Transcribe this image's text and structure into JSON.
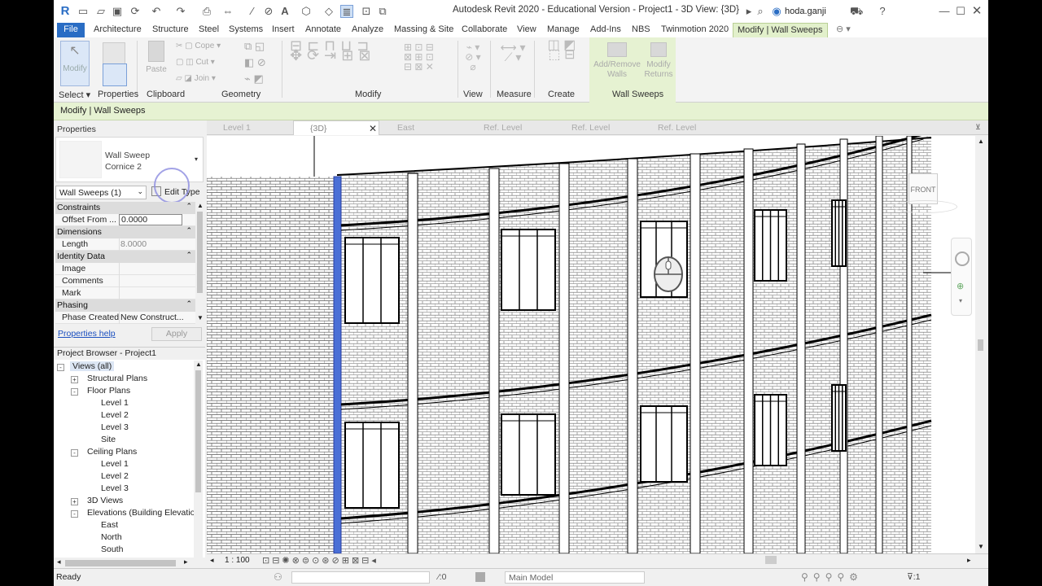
{
  "title": "Autodesk Revit 2020 - Educational Version - Project1 - 3D View: {3D}",
  "user": "hoda.ganji",
  "tabs": [
    "File",
    "Architecture",
    "Structure",
    "Steel",
    "Systems",
    "Insert",
    "Annotate",
    "Analyze",
    "Massing & Site",
    "Collaborate",
    "View",
    "Manage",
    "Add-Ins",
    "NBS",
    "Twinmotion 2020",
    "Modify | Wall Sweeps"
  ],
  "ribbon": {
    "modify_label": "Modify",
    "paste_label": "Paste",
    "cope_label": "Cope",
    "cut_label": "Cut",
    "join_label": "Join",
    "add_remove_walls": [
      "Add/Remove",
      "Walls"
    ],
    "modify_returns": [
      "Modify",
      "Returns"
    ],
    "panels": [
      "Select",
      "Properties",
      "Clipboard",
      "Geometry",
      "Modify",
      "View",
      "Measure",
      "Create",
      "Wall Sweeps"
    ]
  },
  "options_bar": "Modify | Wall Sweeps",
  "properties": {
    "title": "Properties",
    "family": "Wall Sweep",
    "type": "Cornice 2",
    "instance_filter": "Wall Sweeps (1)",
    "edit_type": "Edit Type",
    "rows": [
      {
        "kind": "group",
        "label": "Constraints"
      },
      {
        "kind": "item",
        "label": "Offset From ...",
        "value": "0.0000"
      },
      {
        "kind": "group",
        "label": "Dimensions"
      },
      {
        "kind": "item",
        "label": "Length",
        "value": "8.0000"
      },
      {
        "kind": "group",
        "label": "Identity Data"
      },
      {
        "kind": "item",
        "label": "Image",
        "value": ""
      },
      {
        "kind": "item",
        "label": "Comments",
        "value": ""
      },
      {
        "kind": "item",
        "label": "Mark",
        "value": ""
      },
      {
        "kind": "group",
        "label": "Phasing"
      },
      {
        "kind": "item",
        "label": "Phase Created",
        "value": "New Construct..."
      }
    ],
    "help": "Properties help",
    "apply": "Apply"
  },
  "browser": {
    "title": "Project Browser - Project1",
    "items": [
      {
        "label": "Views (all)",
        "level": 0,
        "pm": "-",
        "selected": true
      },
      {
        "label": "Structural Plans",
        "level": 1,
        "pm": "+"
      },
      {
        "label": "Floor Plans",
        "level": 1,
        "pm": "-"
      },
      {
        "label": "Level 1",
        "level": 2
      },
      {
        "label": "Level 2",
        "level": 2
      },
      {
        "label": "Level 3",
        "level": 2
      },
      {
        "label": "Site",
        "level": 2
      },
      {
        "label": "Ceiling Plans",
        "level": 1,
        "pm": "-"
      },
      {
        "label": "Level 1",
        "level": 2
      },
      {
        "label": "Level 2",
        "level": 2
      },
      {
        "label": "Level 3",
        "level": 2
      },
      {
        "label": "3D Views",
        "level": 1,
        "pm": "+"
      },
      {
        "label": "Elevations (Building Elevation",
        "level": 1,
        "pm": "-"
      },
      {
        "label": "East",
        "level": 2
      },
      {
        "label": "North",
        "level": 2
      },
      {
        "label": "South",
        "level": 2
      }
    ]
  },
  "view_tabs": [
    "Level 1",
    "{3D}",
    "East",
    "Ref. Level",
    "Ref. Level",
    "Ref. Level"
  ],
  "view_cube": "FRONT",
  "view_scale": "1 : 100",
  "status": {
    "left": "Ready",
    "count": ":0",
    "model": "Main Model",
    "filter_count": ":1"
  },
  "colors": {
    "file_tab": "#2a6dc4",
    "context": "#e6f2d2",
    "selection": "#4a6fd6"
  }
}
